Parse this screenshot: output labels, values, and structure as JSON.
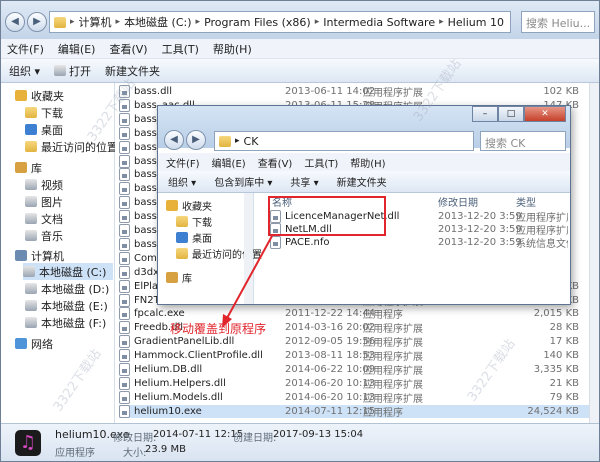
{
  "address": {
    "segments": [
      "计算机",
      "本地磁盘 (C:)",
      "Program Files (x86)",
      "Intermedia Software",
      "Helium 10"
    ],
    "search_placeholder": "搜索 Heliu..."
  },
  "menu": [
    "文件(F)",
    "编辑(E)",
    "查看(V)",
    "工具(T)",
    "帮助(H)"
  ],
  "toolbar": {
    "organize": "组织 ▾",
    "open": "打开",
    "new_folder": "新建文件夹"
  },
  "nav": {
    "favorites": "收藏夹",
    "downloads": "下载",
    "desktop": "桌面",
    "recent": "最近访问的位置",
    "libraries": "库",
    "videos": "视频",
    "pictures": "图片",
    "documents": "文档",
    "music": "音乐",
    "computer": "计算机",
    "drive_c": "本地磁盘 (C:)",
    "drive_d": "本地磁盘 (D:)",
    "drive_e": "本地磁盘 (E:)",
    "drive_f": "本地磁盘 (F:)",
    "network": "网络"
  },
  "files": [
    {
      "name": "bass.dll",
      "date": "2013-06-11 14:02",
      "type": "应用程序扩展",
      "size": "102 KB"
    },
    {
      "name": "bass_aac.dll",
      "date": "2013-06-11 15:28",
      "type": "应用程序扩展",
      "size": "147 KB"
    },
    {
      "name": "bass_",
      "date": "",
      "type": "",
      "size": ""
    },
    {
      "name": "bass_",
      "date": "",
      "type": "",
      "size": ""
    },
    {
      "name": "bass_",
      "date": "",
      "type": "",
      "size": ""
    },
    {
      "name": "bass_",
      "date": "",
      "type": "",
      "size": ""
    },
    {
      "name": "bass_",
      "date": "",
      "type": "",
      "size": ""
    },
    {
      "name": "bass_",
      "date": "",
      "type": "",
      "size": ""
    },
    {
      "name": "bass_",
      "date": "",
      "type": "",
      "size": ""
    },
    {
      "name": "bassfl",
      "date": "",
      "type": "",
      "size": ""
    },
    {
      "name": "bassfl",
      "date": "",
      "type": "",
      "size": ""
    },
    {
      "name": "bassw",
      "date": "",
      "type": "",
      "size": ""
    },
    {
      "name": "Com.V",
      "date": "",
      "type": "",
      "size": ""
    },
    {
      "name": "d3dx9_",
      "date": "",
      "type": "",
      "size": ""
    },
    {
      "name": "ElPlayerNet.dll",
      "date": "2014-03-16 20:01",
      "type": "应用程序扩展",
      "size": "6 KB"
    },
    {
      "name": "FN2TCommWrapper.dll",
      "date": "2014-03-16 20:02",
      "type": "应用程序扩展",
      "size": "11 KB"
    },
    {
      "name": "fpcalc.exe",
      "date": "2011-12-22 14:44",
      "type": "应用程序",
      "size": "2,015 KB"
    },
    {
      "name": "Freedb.dll",
      "date": "2014-03-16 20:02",
      "type": "应用程序扩展",
      "size": "28 KB"
    },
    {
      "name": "GradientPanelLib.dll",
      "date": "2012-09-05 19:56",
      "type": "应用程序扩展",
      "size": "17 KB"
    },
    {
      "name": "Hammock.ClientProfile.dll",
      "date": "2013-08-11 18:53",
      "type": "应用程序扩展",
      "size": "140 KB"
    },
    {
      "name": "Helium.DB.dll",
      "date": "2014-06-22 10:09",
      "type": "应用程序扩展",
      "size": "3,335 KB"
    },
    {
      "name": "Helium.Helpers.dll",
      "date": "2014-06-20 10:13",
      "type": "应用程序扩展",
      "size": "21 KB"
    },
    {
      "name": "Helium.Models.dll",
      "date": "2014-06-20 10:13",
      "type": "应用程序扩展",
      "size": "79 KB"
    },
    {
      "name": "helium10.exe",
      "date": "2014-07-11 12:15",
      "type": "应用程序",
      "size": "24,524 KB"
    }
  ],
  "details": {
    "name": "helium10.exe",
    "modified_label": "修改日期:",
    "modified": "2014-07-11 12:15",
    "created_label": "创建日期:",
    "created": "2017-09-13 15:04",
    "type": "应用程序",
    "size_label": "大小:",
    "size": "23.9 MB"
  },
  "child": {
    "address": "CK",
    "search_placeholder": "搜索 CK",
    "menu": [
      "文件(F)",
      "编辑(E)",
      "查看(V)",
      "工具(T)",
      "帮助(H)"
    ],
    "toolbar": {
      "organize": "组织 ▾",
      "include": "包含到库中 ▾",
      "share": "共享 ▾",
      "new_folder": "新建文件夹"
    },
    "col_name": "名称",
    "col_date": "修改日期",
    "col_type": "类型",
    "nav": {
      "favorites": "收藏夹",
      "downloads": "下载",
      "desktop": "桌面",
      "recent": "最近访问的位置",
      "libraries": "库"
    },
    "files": [
      {
        "name": "LicenceManagerNet.dll",
        "date": "2013-12-20 3:59",
        "type": "应用程序扩展"
      },
      {
        "name": "NetLM.dll",
        "date": "2013-12-20 3:59",
        "type": "应用程序扩展"
      },
      {
        "name": "PACE.nfo",
        "date": "2013-12-20 3:59",
        "type": "系统信息文件"
      }
    ]
  },
  "annotation": "移动覆盖到原程序",
  "watermark": "3322下载站",
  "colors": {
    "annotation": "#e0262c",
    "selection": "#cde1f7"
  }
}
